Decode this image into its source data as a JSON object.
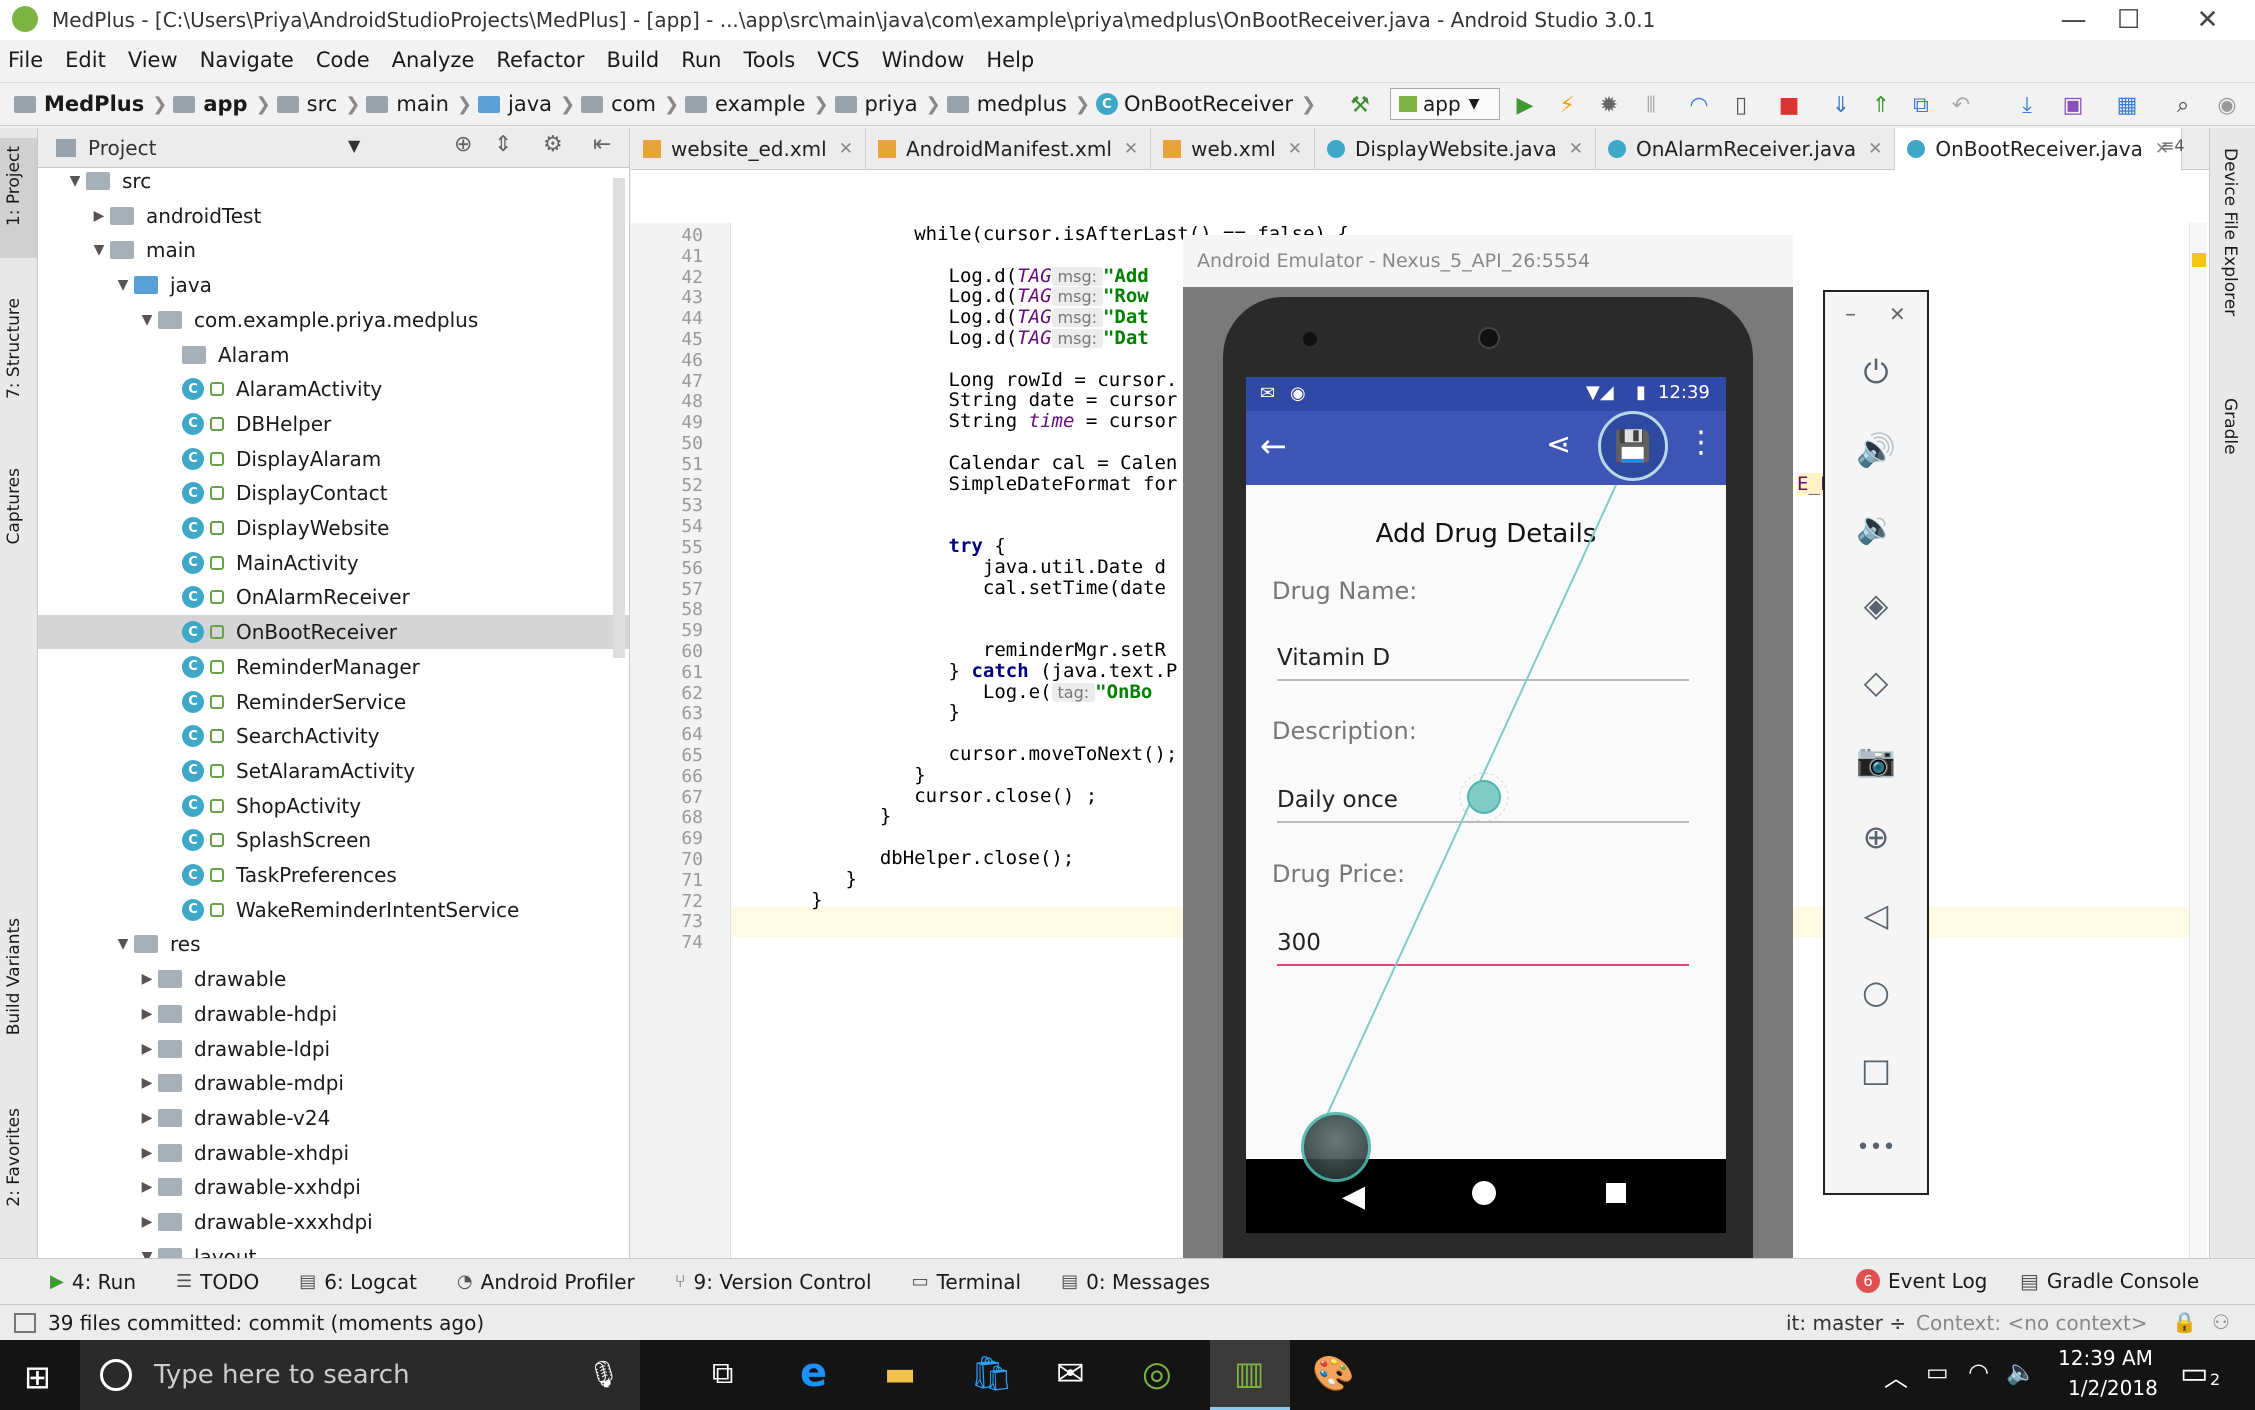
{
  "window": {
    "title": "MedPlus - [C:\\Users\\Priya\\AndroidStudioProjects\\MedPlus] - [app] - ...\\app\\src\\main\\java\\com\\example\\priya\\medplus\\OnBootReceiver.java - Android Studio 3.0.1",
    "minimize": "—",
    "maximize": "☐",
    "close": "✕"
  },
  "menu": [
    "File",
    "Edit",
    "View",
    "Navigate",
    "Code",
    "Analyze",
    "Refactor",
    "Build",
    "Run",
    "Tools",
    "VCS",
    "Window",
    "Help"
  ],
  "breadcrumb": [
    "MedPlus",
    "app",
    "src",
    "main",
    "java",
    "com",
    "example",
    "priya",
    "medplus",
    "OnBootReceiver"
  ],
  "toolbar": {
    "config": "app"
  },
  "left_tools": {
    "project": "1: Project",
    "structure": "7: Structure",
    "captures": "Captures",
    "build_variants": "Build Variants",
    "favorites": "2: Favorites"
  },
  "right_tools": {
    "device_explorer": "Device File Explorer",
    "gradle": "Gradle"
  },
  "project_panel": {
    "header": "Project",
    "tree": [
      {
        "label": "src",
        "depth": 2,
        "type": "folder",
        "arrow": "▼"
      },
      {
        "label": "androidTest",
        "depth": 3,
        "type": "folder",
        "arrow": "▶"
      },
      {
        "label": "main",
        "depth": 3,
        "type": "folder",
        "arrow": "▼"
      },
      {
        "label": "java",
        "depth": 4,
        "type": "folder",
        "arrow": "▼"
      },
      {
        "label": "com.example.priya.medplus",
        "depth": 5,
        "type": "folder",
        "arrow": "▼"
      },
      {
        "label": "Alaram",
        "depth": 6,
        "type": "folder",
        "arrow": ""
      },
      {
        "label": "AlaramActivity",
        "depth": 6,
        "type": "class"
      },
      {
        "label": "DBHelper",
        "depth": 6,
        "type": "class"
      },
      {
        "label": "DisplayAlaram",
        "depth": 6,
        "type": "class"
      },
      {
        "label": "DisplayContact",
        "depth": 6,
        "type": "class"
      },
      {
        "label": "DisplayWebsite",
        "depth": 6,
        "type": "class"
      },
      {
        "label": "MainActivity",
        "depth": 6,
        "type": "class"
      },
      {
        "label": "OnAlarmReceiver",
        "depth": 6,
        "type": "class"
      },
      {
        "label": "OnBootReceiver",
        "depth": 6,
        "type": "class",
        "selected": true
      },
      {
        "label": "ReminderManager",
        "depth": 6,
        "type": "class"
      },
      {
        "label": "ReminderService",
        "depth": 6,
        "type": "class"
      },
      {
        "label": "SearchActivity",
        "depth": 6,
        "type": "class"
      },
      {
        "label": "SetAlaramActivity",
        "depth": 6,
        "type": "class"
      },
      {
        "label": "ShopActivity",
        "depth": 6,
        "type": "class"
      },
      {
        "label": "SplashScreen",
        "depth": 6,
        "type": "class"
      },
      {
        "label": "TaskPreferences",
        "depth": 6,
        "type": "class"
      },
      {
        "label": "WakeReminderIntentService",
        "depth": 6,
        "type": "class"
      },
      {
        "label": "res",
        "depth": 4,
        "type": "folder",
        "arrow": "▼"
      },
      {
        "label": "drawable",
        "depth": 5,
        "type": "folder",
        "arrow": "▶"
      },
      {
        "label": "drawable-hdpi",
        "depth": 5,
        "type": "folder",
        "arrow": "▶"
      },
      {
        "label": "drawable-ldpi",
        "depth": 5,
        "type": "folder",
        "arrow": "▶"
      },
      {
        "label": "drawable-mdpi",
        "depth": 5,
        "type": "folder",
        "arrow": "▶"
      },
      {
        "label": "drawable-v24",
        "depth": 5,
        "type": "folder",
        "arrow": "▶"
      },
      {
        "label": "drawable-xhdpi",
        "depth": 5,
        "type": "folder",
        "arrow": "▶"
      },
      {
        "label": "drawable-xxhdpi",
        "depth": 5,
        "type": "folder",
        "arrow": "▶"
      },
      {
        "label": "drawable-xxxhdpi",
        "depth": 5,
        "type": "folder",
        "arrow": "▶"
      },
      {
        "label": "layout",
        "depth": 5,
        "type": "folder",
        "arrow": "▼"
      }
    ]
  },
  "tabs": [
    {
      "label": "website_ed.xml",
      "kind": "xml"
    },
    {
      "label": "AndroidManifest.xml",
      "kind": "xml"
    },
    {
      "label": "web.xml",
      "kind": "xml"
    },
    {
      "label": "DisplayWebsite.java",
      "kind": "class"
    },
    {
      "label": "OnAlarmReceiver.java",
      "kind": "class"
    },
    {
      "label": "OnBootReceiver.java",
      "kind": "class",
      "active": true
    }
  ],
  "tab_overflow": "≡4",
  "code": {
    "line_numbers": [
      "40",
      "41",
      "42",
      "43",
      "44",
      "45",
      "46",
      "47",
      "48",
      "49",
      "50",
      "51",
      "52",
      "53",
      "54",
      "55",
      "56",
      "57",
      "58",
      "59",
      "60",
      "61",
      "62",
      "63",
      "64",
      "65",
      "66",
      "67",
      "68",
      "69",
      "70",
      "71",
      "72",
      "73",
      "74"
    ],
    "log_lines": [
      {
        "p": "Log.d(",
        "tag": "TAG",
        "hint": "msg:",
        "s": "\"Add"
      },
      {
        "p": "Log.d(",
        "tag": "TAG",
        "hint": "msg:",
        "s": "\"Row"
      },
      {
        "p": "Log.d(",
        "tag": "TAG",
        "hint": "msg:",
        "s": "\"Dat"
      },
      {
        "p": "Log.d(",
        "tag": "TAG",
        "hint": "msg:",
        "s": "\"Dat"
      }
    ],
    "l40": "while(cursor.isAfterLast() == false) {",
    "l47": "Long rowId = cursor.",
    "l48": "String date = cursor",
    "l49a": "String ",
    "l49b": "time",
    "l49c": " = cursor",
    "l51": "Calendar cal = Calen",
    "l52": "SimpleDateFormat for",
    "l55a": "try",
    "l55b": " {",
    "l56": "java.util.Date d",
    "l57": "cal.setTime(date",
    "l60": "reminderMgr.setR",
    "l61a": "} ",
    "l61b": "catch",
    "l61c": " (java.text.P",
    "l62a": "Log.e(",
    "l62b": "tag:",
    "l62c": "\"OnBo",
    "l63": "}",
    "l65": "cursor.moveToNext();",
    "l66": "}",
    "l67": "cursor.close() ;",
    "l68": "}",
    "l70": "dbHelper.close();",
    "l71": "}",
    "l72": "}",
    "l52tail": "E_F"
  },
  "emulator": {
    "title": "Android Emulator - Nexus_5_API_26:5554",
    "time": "12:39",
    "screen_title": "Add Drug Details",
    "fields": [
      {
        "label": "Drug Name:",
        "value": "Vitamin D"
      },
      {
        "label": "Description:",
        "value": "Daily once"
      },
      {
        "label": "Drug Price:",
        "value": "300"
      }
    ],
    "side_controls": {
      "minimize": "–",
      "close": "✕",
      "more": "•••"
    }
  },
  "bottom_tabs": [
    {
      "label": "4: Run",
      "icon": "▶"
    },
    {
      "label": "TODO",
      "icon": "☰"
    },
    {
      "label": "6: Logcat",
      "icon": "▤"
    },
    {
      "label": "Android Profiler",
      "icon": "◔"
    },
    {
      "label": "9: Version Control",
      "icon": "⑂"
    },
    {
      "label": "Terminal",
      "icon": "▭"
    },
    {
      "label": "0: Messages",
      "icon": "▤"
    }
  ],
  "bottom_right_tabs": [
    {
      "label": "Event Log",
      "badge": "6"
    },
    {
      "label": "Gradle Console",
      "icon": "▤"
    }
  ],
  "status": {
    "message": "39 files committed: commit (moments ago)",
    "branch": "it: master ÷",
    "context": "Context: <no context>"
  },
  "taskbar": {
    "search_placeholder": "Type here to search",
    "time": "12:39 AM",
    "date": "1/2/2018",
    "notif_count": "2"
  },
  "colors": {
    "appbar": "#3f55b5",
    "statusbar": "#3049a7",
    "accent": "#ec407a",
    "teal": "#80cbc4"
  }
}
